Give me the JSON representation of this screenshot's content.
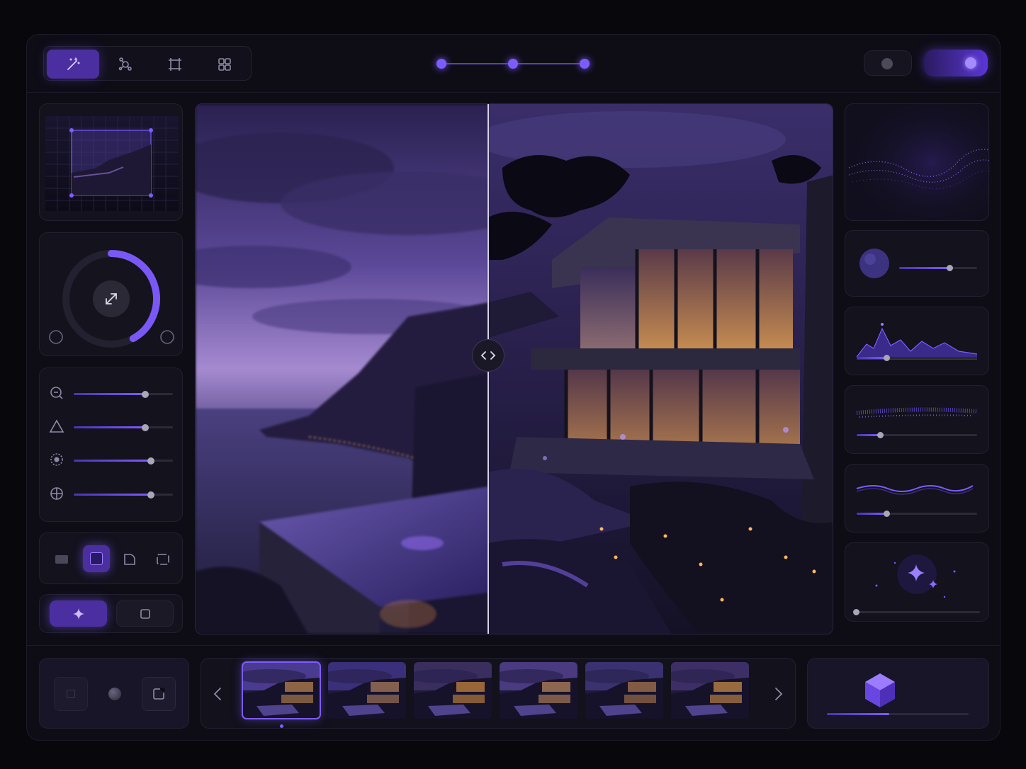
{
  "toolbar": {
    "tools": [
      {
        "name": "magic-wand-icon",
        "active": true
      },
      {
        "name": "node-graph-icon",
        "active": false
      },
      {
        "name": "crop-icon",
        "active": false
      },
      {
        "name": "grid-layout-icon",
        "active": false
      }
    ]
  },
  "stepper": {
    "steps": 3,
    "current": 1
  },
  "toggles": [
    {
      "name": "toggle-off",
      "on": false
    },
    {
      "name": "toggle-on",
      "on": true
    }
  ],
  "adjustments": {
    "ring_progress": 0.42,
    "sliders": [
      {
        "name": "zoom-slider",
        "icon": "zoom-icon",
        "value": 0.72
      },
      {
        "name": "shape-slider",
        "icon": "triangle-icon",
        "value": 0.72
      },
      {
        "name": "focus-slider",
        "icon": "focus-icon",
        "value": 0.78
      },
      {
        "name": "target-slider",
        "icon": "crosshair-icon",
        "value": 0.78
      }
    ]
  },
  "effects": [
    {
      "name": "sphere-effect",
      "value": 0.65
    },
    {
      "name": "mountain-effect",
      "value": 0.25
    },
    {
      "name": "sparkle-line-effect",
      "value": 0.2
    },
    {
      "name": "wave-effect",
      "value": 0.25
    },
    {
      "name": "stars-effect",
      "value": 0.0
    }
  ],
  "export_progress": 0.44,
  "colors": {
    "accent": "#7d5cff",
    "accent_dark": "#4b2fa0",
    "panel": "#13121d"
  }
}
